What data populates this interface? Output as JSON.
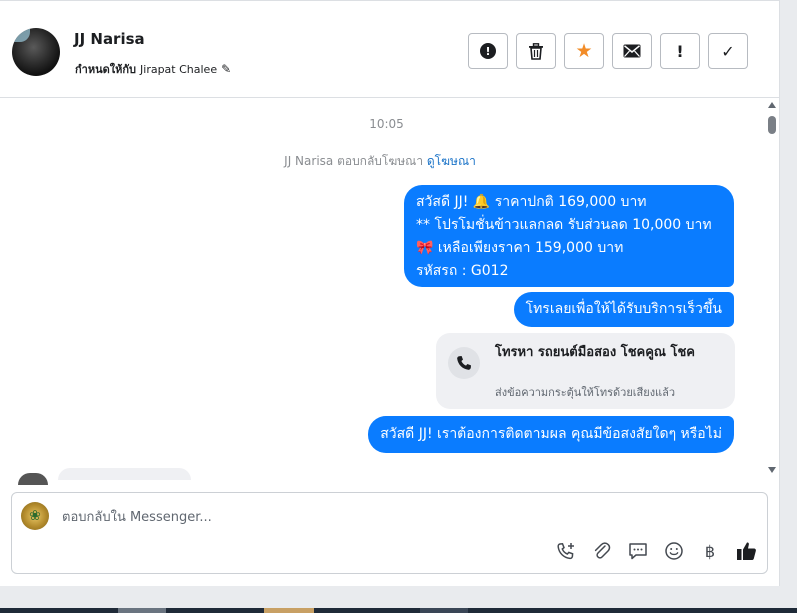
{
  "header": {
    "contact_name": "JJ Narisa",
    "assigned_label": "กำหนดให้กับ",
    "assigned_to": "Jirapat Chalee",
    "actions": [
      {
        "name": "report-spam-button",
        "icon": "alert-circle-icon",
        "glyph": "!"
      },
      {
        "name": "delete-button",
        "icon": "trash-icon",
        "glyph": "🗑"
      },
      {
        "name": "star-button",
        "icon": "star-icon",
        "glyph": "★"
      },
      {
        "name": "mark-unread-button",
        "icon": "envelope-icon",
        "glyph": "✉"
      },
      {
        "name": "follow-up-button",
        "icon": "exclamation-icon",
        "glyph": "!"
      },
      {
        "name": "mark-done-button",
        "icon": "checkmark-icon",
        "glyph": "✓"
      }
    ]
  },
  "conversation": {
    "timestamp": "10:05",
    "ad_reply_text": "JJ Narisa ตอบกลับโฆษณา",
    "ad_reply_link": "ดูโฆษณา",
    "messages": [
      {
        "lines": [
          "สวัสดี JJ! 🔔 ราคาปกติ 169,000 บาท",
          "** โปรโมชั่นข้าวแลกลด รับส่วนลด 10,000 บาท",
          "🎀  เหลือเพียงราคา 159,000 บาท",
          " รหัสรถ : G012"
        ]
      },
      {
        "text": "โทรเลยเพื่อให้ได้รับบริการเร็วขึ้น"
      },
      {
        "text": "สวัสดี JJ! เราต้องการติดตามผล คุณมีข้อสงสัยใดๆ หรือไม่"
      }
    ],
    "call_card": {
      "title": "โทรหา รถยนต์มือสอง โชคคูณ โชค",
      "subtitle": "ส่งข้อความกระตุ้นให้โทรด้วยเสียงแล้ว",
      "icon": "phone-icon"
    }
  },
  "composer": {
    "placeholder": "ตอบกลับใน Messenger...",
    "tools": [
      {
        "name": "add-call-button",
        "icon": "phone-plus-icon",
        "glyph": "📞"
      },
      {
        "name": "attach-button",
        "icon": "paperclip-icon",
        "glyph": "📎"
      },
      {
        "name": "saved-replies-button",
        "icon": "chat-bubble-icon",
        "glyph": "💬"
      },
      {
        "name": "emoji-button",
        "icon": "smiley-icon",
        "glyph": "☺"
      },
      {
        "name": "payment-button",
        "icon": "baht-icon",
        "glyph": "฿"
      },
      {
        "name": "like-button",
        "icon": "thumbs-up-icon",
        "glyph": "👍"
      }
    ]
  }
}
